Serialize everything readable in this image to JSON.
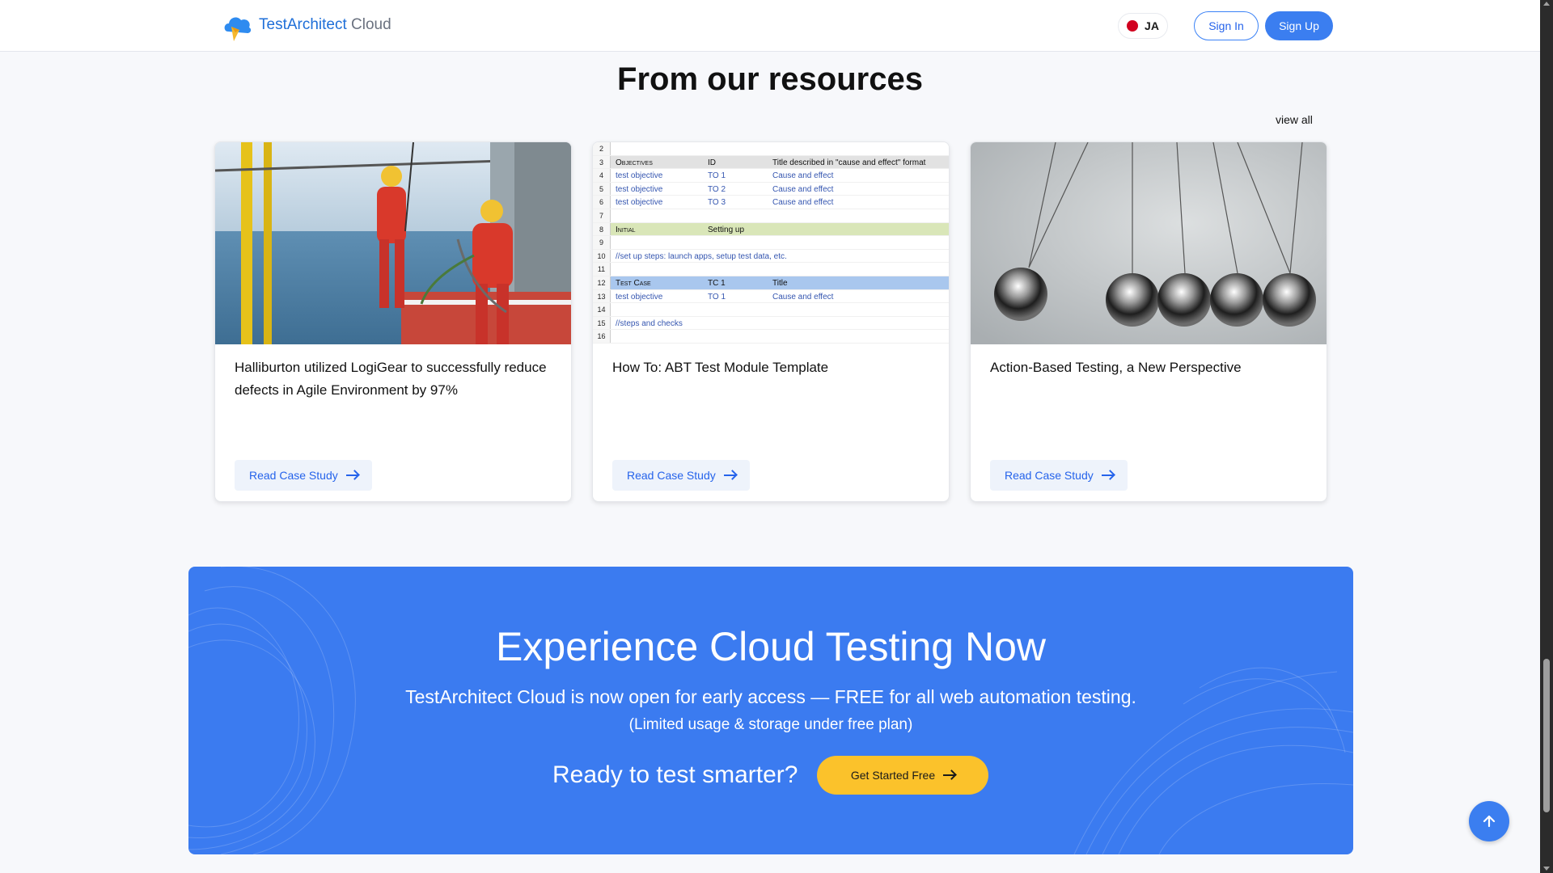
{
  "header": {
    "brand_main": "TestArchitect",
    "brand_sub": "Cloud",
    "lang_label": "JA",
    "signin_label": "Sign In",
    "signup_label": "Sign Up"
  },
  "resources": {
    "title": "From our resources",
    "view_all": "view all",
    "cards": [
      {
        "title": "Halliburton utilized LogiGear to successfully reduce defects in Agile Environment by 97%",
        "button": "Read Case Study",
        "image": "offshore-workers-photo"
      },
      {
        "title": "How To: ABT Test Module Template",
        "button": "Read Case Study",
        "image": "spreadsheet-template"
      },
      {
        "title": "Action-Based Testing, a New Perspective",
        "button": "Read Case Study",
        "image": "newtons-cradle-photo"
      }
    ]
  },
  "sheet": {
    "rows": [
      {
        "n": "2",
        "cols": []
      },
      {
        "n": "3",
        "cols": [
          "Objectives",
          "ID",
          "Title described in \"cause and effect\" format"
        ],
        "style": "header"
      },
      {
        "n": "4",
        "cols": [
          "test objective",
          "TO 1",
          "Cause and effect"
        ],
        "style": "blue"
      },
      {
        "n": "5",
        "cols": [
          "test objective",
          "TO 2",
          "Cause and effect"
        ],
        "style": "blue"
      },
      {
        "n": "6",
        "cols": [
          "test objective",
          "TO 3",
          "Cause and effect"
        ],
        "style": "blue"
      },
      {
        "n": "7",
        "cols": []
      },
      {
        "n": "8",
        "cols": [
          "Initial",
          "Setting up"
        ],
        "style": "green"
      },
      {
        "n": "9",
        "cols": []
      },
      {
        "n": "10",
        "cols": [
          "//set up steps: launch apps, setup test data, etc."
        ],
        "style": "blue"
      },
      {
        "n": "11",
        "cols": []
      },
      {
        "n": "12",
        "cols": [
          "Test Case",
          "TC 1",
          "Title"
        ],
        "style": "highlight"
      },
      {
        "n": "13",
        "cols": [
          "test objective",
          "TO 1",
          "Cause and effect"
        ],
        "style": "blue"
      },
      {
        "n": "14",
        "cols": []
      },
      {
        "n": "15",
        "cols": [
          "//steps and checks"
        ],
        "style": "blue"
      },
      {
        "n": "16",
        "cols": []
      }
    ]
  },
  "cta": {
    "title": "Experience Cloud Testing Now",
    "subtitle": "TestArchitect Cloud is now open for early access — FREE for all web automation testing.",
    "note": "(Limited usage & storage under free plan)",
    "ready": "Ready to test smarter?",
    "button": "Get Started Free"
  },
  "colors": {
    "brand_blue": "#3b7ef0",
    "cta_yellow": "#fbc22b",
    "flag_red": "#d1001f"
  },
  "icons": {
    "back_to_top": "arrow-up-icon",
    "cta_arrow": "arrow-right-icon",
    "card_arrow": "arrow-right-icon"
  }
}
